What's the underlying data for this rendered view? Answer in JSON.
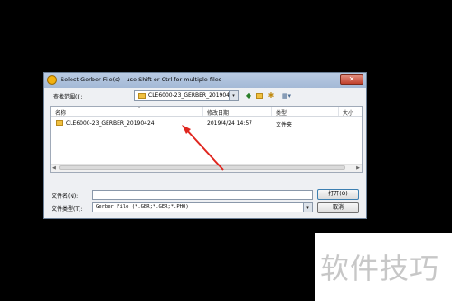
{
  "dialog": {
    "title": "Select Gerber File(s) - use Shift or Ctrl for multiple files",
    "close_glyph": "✕"
  },
  "toolbar": {
    "lookin_label": "查找范围(I):",
    "lookin_value": "CLE6000-23_GERBER_20190424",
    "combo_arrow": "▾",
    "back_glyph": "◆",
    "newfolder_glyph": "✱",
    "view_glyph": "▦▾"
  },
  "list": {
    "columns": [
      "名称",
      "修改日期",
      "类型",
      "大小"
    ],
    "sort_caret": "^",
    "rows": [
      {
        "name": "CLE6000-23_GERBER_20190424",
        "date": "2019/4/24 14:57",
        "type": "文件夹",
        "icon": "folder-icon"
      }
    ],
    "scroll_left": "◀",
    "scroll_right": "▶"
  },
  "footer": {
    "filename_label": "文件名(N):",
    "filename_value": "",
    "filetype_label": "文件类型(T):",
    "filetype_value": "Gerber File (*.GBR;*.GER;*.PHO)",
    "filetype_arrow": "▾",
    "open_label": "打开(O)",
    "cancel_label": "取消"
  },
  "watermark": {
    "text": "软件技巧"
  },
  "colors": {
    "annotation_arrow": "#e0261f",
    "titlebar": "#b9cbe3",
    "folder": "#f0c040"
  }
}
